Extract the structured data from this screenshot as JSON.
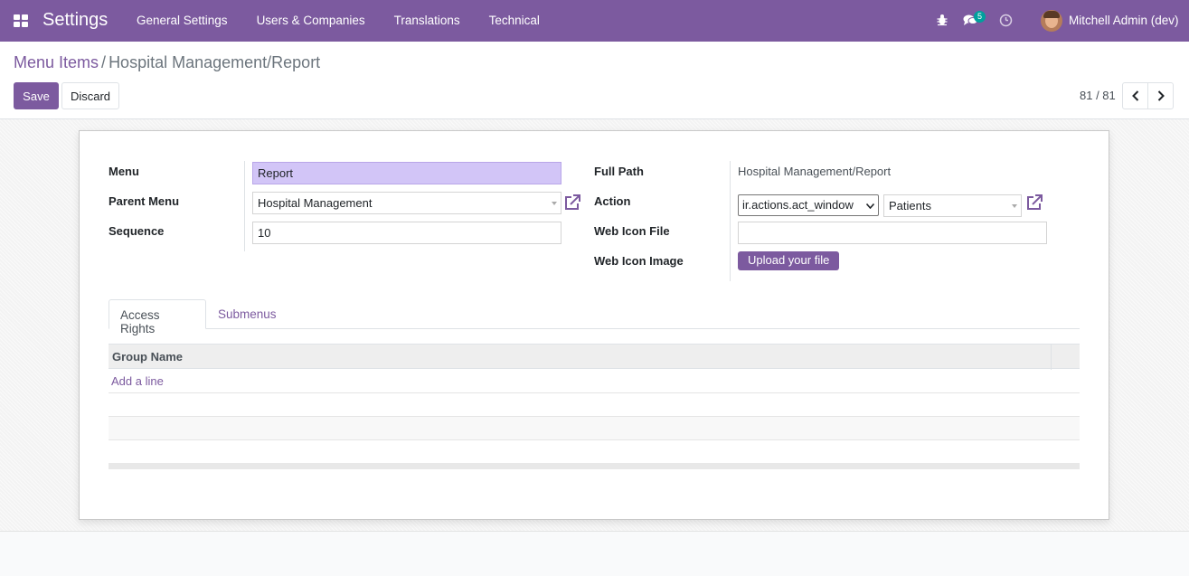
{
  "navbar": {
    "brand": "Settings",
    "menu": [
      "General Settings",
      "Users & Companies",
      "Translations",
      "Technical"
    ],
    "chat_count": "5",
    "user_name": "Mitchell Admin (dev)"
  },
  "breadcrumb": {
    "parent": "Menu Items",
    "separator": "/",
    "current": "Hospital Management/Report"
  },
  "toolbar": {
    "save_label": "Save",
    "discard_label": "Discard"
  },
  "pager": {
    "value": "81 / 81"
  },
  "form": {
    "menu_label": "Menu",
    "menu_value": "Report",
    "parent_menu_label": "Parent Menu",
    "parent_menu_value": "Hospital Management",
    "sequence_label": "Sequence",
    "sequence_value": "10",
    "full_path_label": "Full Path",
    "full_path_value": "Hospital Management/Report",
    "action_label": "Action",
    "action_type_value": "ir.actions.act_window",
    "action_value": "Patients",
    "web_icon_file_label": "Web Icon File",
    "web_icon_file_value": "",
    "web_icon_image_label": "Web Icon Image",
    "upload_label": "Upload your file"
  },
  "tabs": [
    {
      "label": "Access Rights",
      "active": true
    },
    {
      "label": "Submenus",
      "active": false
    }
  ],
  "table": {
    "columns": [
      "Group Name"
    ],
    "add_line_label": "Add a line"
  },
  "colors": {
    "brand": "#7c5a9f",
    "required_field": "#d2c5f7",
    "badge": "#00a09d"
  }
}
